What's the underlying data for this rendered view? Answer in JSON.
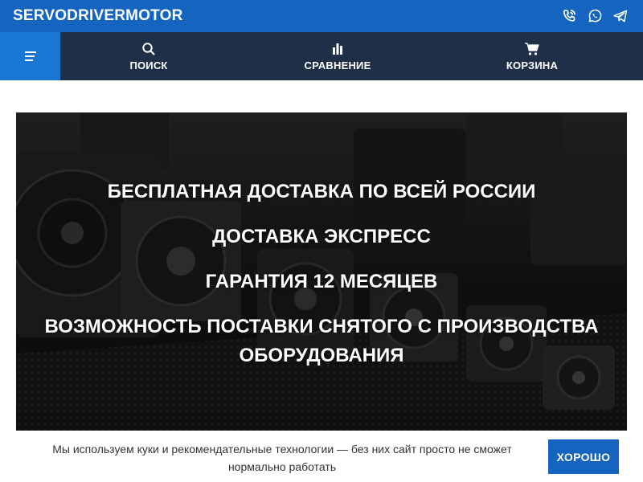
{
  "header": {
    "brand": "SERVODRIVERMOTOR",
    "contact_icons": [
      "phone-icon",
      "whatsapp-icon",
      "telegram-icon"
    ]
  },
  "nav": {
    "menu_icon": "hamburger-menu-icon",
    "items": [
      {
        "label": "ПОИСК",
        "icon": "search-icon"
      },
      {
        "label": "СРАВНЕНИЕ",
        "icon": "compare-bars-icon"
      },
      {
        "label": "КОРЗИНА",
        "icon": "cart-icon"
      }
    ]
  },
  "banner": {
    "lines": [
      "БЕСПЛАТНАЯ ДОСТАВКА ПО ВСЕЙ РОССИИ",
      "ДОСТАВКА ЭКСПРЕСС",
      "ГАРАНТИЯ 12 МЕСЯЦЕВ",
      "ВОЗМОЖНОСТЬ ПОСТАВКИ СНЯТОГО С ПРОИЗВОДСТВА ОБОРУДОВАНИЯ"
    ]
  },
  "cookie": {
    "text": "Мы используем куки и рекомендательные технологии — без них сайт просто не сможет нормально работать",
    "button_label": "ХОРОШО"
  },
  "colors": {
    "topbar": "#1565c0",
    "navbar": "#1e2f47",
    "menu_button": "#1976d2",
    "accent": "#1565c0"
  }
}
